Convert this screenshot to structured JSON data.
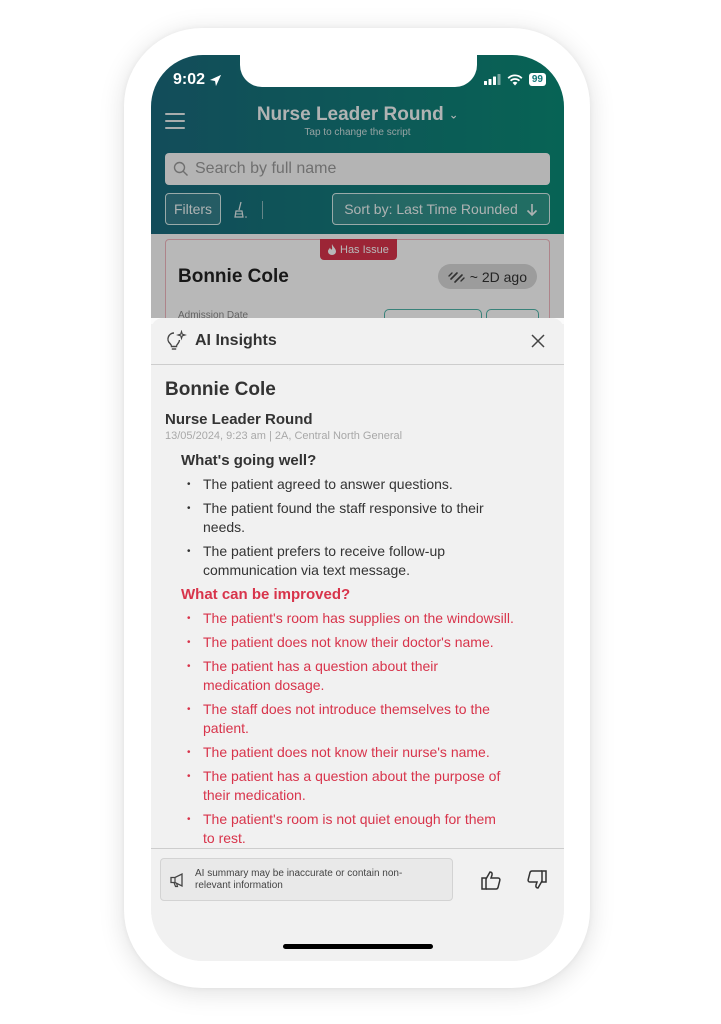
{
  "status_bar": {
    "time": "9:02",
    "battery": "99"
  },
  "header": {
    "script_title": "Nurse Leader Round",
    "script_subtitle": "Tap to change the script",
    "search_placeholder": "Search by full name",
    "filters_label": "Filters",
    "sort_label": "Sort by: Last Time Rounded"
  },
  "patient_card": {
    "badge": "Has Issue",
    "name": "Bonnie Cole",
    "last_rounded": "~ 2D ago",
    "admission_label": "Admission Date"
  },
  "ai_insights": {
    "title": "AI Insights",
    "patient_name": "Bonnie Cole",
    "round_name": "Nurse Leader Round",
    "round_meta": "13/05/2024, 9:23 am | 2A, Central North General",
    "going_well": {
      "title": "What's going well?",
      "items": [
        "The patient agreed to answer questions.",
        "The patient found the staff responsive to their needs.",
        "The patient prefers to receive follow-up communication via text message."
      ]
    },
    "improve": {
      "title": "What can be improved?",
      "items": [
        "The patient's room has supplies on the windowsill.",
        "The patient does not know their doctor's name.",
        "The patient has a question about their medication dosage.",
        "The staff does not introduce themselves to the patient.",
        "The patient does not know their nurse's name.",
        "The patient has a question about the purpose of their medication.",
        "The patient's room is not quiet enough for them to rest."
      ]
    },
    "disclaimer": "AI summary may be inaccurate or contain non-relevant information"
  },
  "colors": {
    "brand_teal": "#137a7a",
    "issue_red": "#d8344b",
    "sheet_bg": "#f1f1f1"
  }
}
